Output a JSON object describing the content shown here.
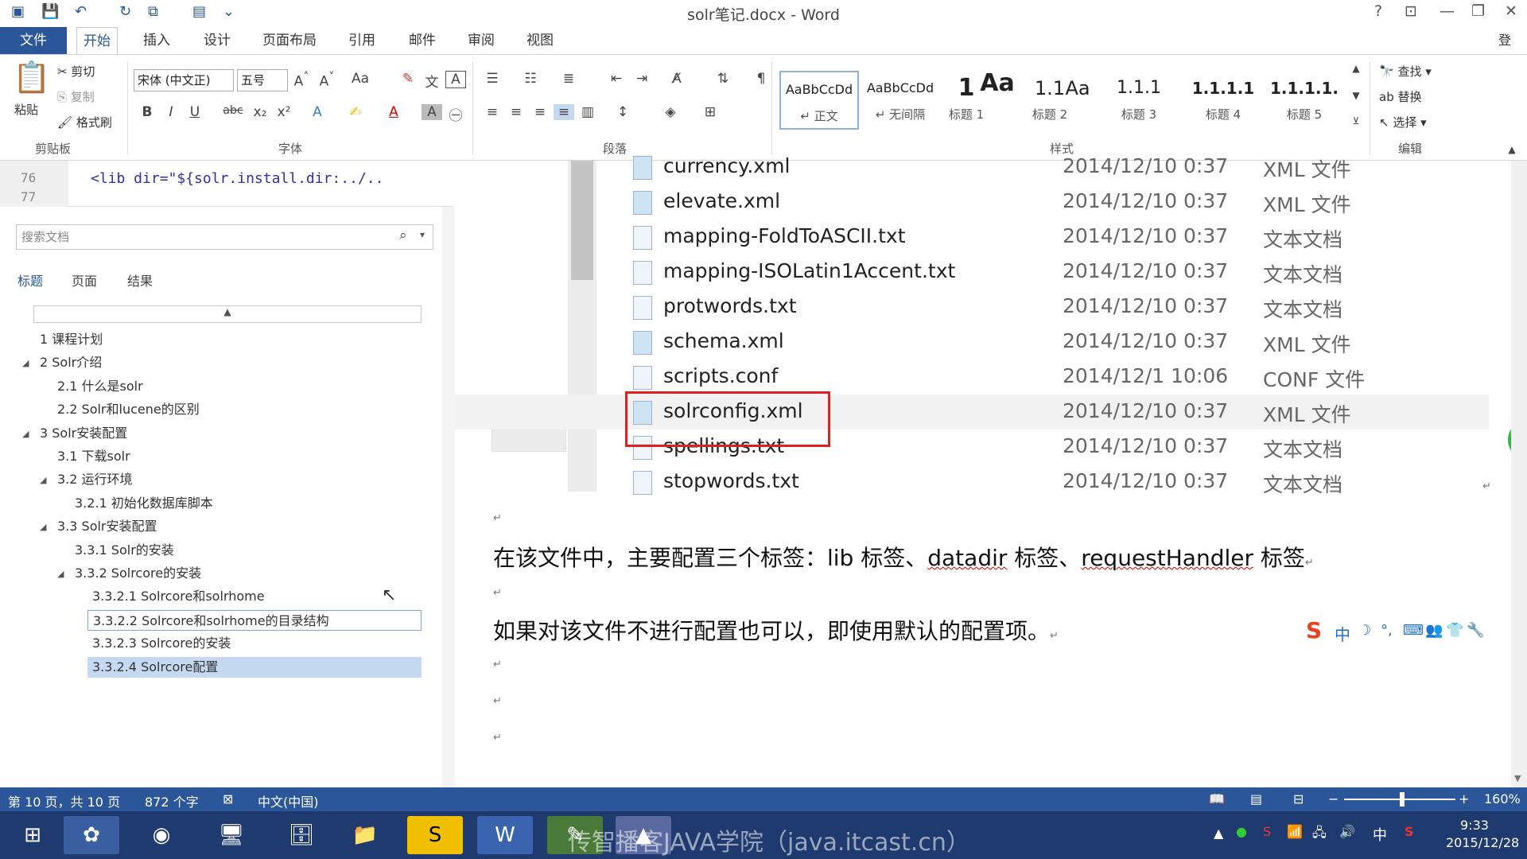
{
  "window": {
    "title": "solr笔记.docx - Word",
    "signin": "登录",
    "help": "?"
  },
  "tabs": [
    "文件",
    "开始",
    "插入",
    "设计",
    "页面布局",
    "引用",
    "邮件",
    "审阅",
    "视图"
  ],
  "ribbon": {
    "clipboard": {
      "paste": "粘贴",
      "cut": "剪切",
      "copy": "复制",
      "format_painter": "格式刷",
      "label": "剪贴板"
    },
    "font": {
      "name": "宋体 (中文正)",
      "size": "五号",
      "label": "字体"
    },
    "paragraph": {
      "label": "段落"
    },
    "styles": {
      "label": "样式",
      "items": [
        {
          "preview": "AaBbCcDd",
          "name": "↵ 正文"
        },
        {
          "preview": "AaBbCcDd",
          "name": "↵ 无间隔"
        },
        {
          "preview": "1",
          "name": "标题 1"
        },
        {
          "preview": "Aa",
          "name": ""
        },
        {
          "preview": "1.1",
          "name": "标题 2"
        },
        {
          "preview": "Aa",
          "name": ""
        },
        {
          "preview": "1.1.1",
          "name": "标题 3"
        },
        {
          "preview": "1.1.1.1",
          "name": "标题 4"
        },
        {
          "preview": "1.1.1.1.",
          "name": "标题 5"
        }
      ]
    },
    "editing": {
      "find": "查找",
      "replace": "替换",
      "select": "选择",
      "label": "编辑"
    }
  },
  "code": {
    "lines": [
      {
        "num": "76",
        "text": "<lib dir=\"${solr.install.dir:../.."
      },
      {
        "num": "77",
        "text": ""
      }
    ]
  },
  "nav": {
    "search_placeholder": "搜索文档",
    "tabs": [
      "标题",
      "页面",
      "结果"
    ],
    "items": [
      {
        "text": "1 课程计划",
        "level": 0,
        "arrow": ""
      },
      {
        "text": "2 Solr介绍",
        "level": 0,
        "arrow": "◢"
      },
      {
        "text": "2.1 什么是solr",
        "level": 1,
        "arrow": ""
      },
      {
        "text": "2.2 Solr和lucene的区别",
        "level": 1,
        "arrow": ""
      },
      {
        "text": "3 Solr安装配置",
        "level": 0,
        "arrow": "◢"
      },
      {
        "text": "3.1 下载solr",
        "level": 1,
        "arrow": ""
      },
      {
        "text": "3.2 运行环境",
        "level": 1,
        "arrow": "◢"
      },
      {
        "text": "3.2.1 初始化数据库脚本",
        "level": 2,
        "arrow": ""
      },
      {
        "text": "3.3 Solr安装配置",
        "level": 1,
        "arrow": "◢"
      },
      {
        "text": "3.3.1 Solr的安装",
        "level": 2,
        "arrow": ""
      },
      {
        "text": "3.3.2 Solrcore的安装",
        "level": 2,
        "arrow": "◢"
      },
      {
        "text": "3.3.2.1 Solrcore和solrhome",
        "level": 3,
        "arrow": ""
      },
      {
        "text": "3.3.2.2 Solrcore和solrhome的目录结构",
        "level": 3,
        "arrow": ""
      },
      {
        "text": "3.3.2.3 Solrcore的安装",
        "level": 3,
        "arrow": ""
      },
      {
        "text": "3.3.2.4 Solrcore配置",
        "level": 3,
        "arrow": ""
      }
    ]
  },
  "files": [
    {
      "name": "currency.xml",
      "date": "2014/12/10 0:37",
      "type": "XML 文件",
      "icon": "xml"
    },
    {
      "name": "elevate.xml",
      "date": "2014/12/10 0:37",
      "type": "XML 文件",
      "icon": "xml"
    },
    {
      "name": "mapping-FoldToASCII.txt",
      "date": "2014/12/10 0:37",
      "type": "文本文档",
      "icon": "txt"
    },
    {
      "name": "mapping-ISOLatin1Accent.txt",
      "date": "2014/12/10 0:37",
      "type": "文本文档",
      "icon": "txt"
    },
    {
      "name": "protwords.txt",
      "date": "2014/12/10 0:37",
      "type": "文本文档",
      "icon": "txt"
    },
    {
      "name": "schema.xml",
      "date": "2014/12/10 0:37",
      "type": "XML 文件",
      "icon": "xml"
    },
    {
      "name": "scripts.conf",
      "date": "2014/12/1 10:06",
      "type": "CONF 文件",
      "icon": "txt"
    },
    {
      "name": "solrconfig.xml",
      "date": "2014/12/10 0:37",
      "type": "XML 文件",
      "icon": "xml"
    },
    {
      "name": "spellings.txt",
      "date": "2014/12/10 0:37",
      "type": "文本文档",
      "icon": "txt"
    },
    {
      "name": "stopwords.txt",
      "date": "2014/12/10 0:37",
      "type": "文本文档",
      "icon": "txt"
    }
  ],
  "doc": {
    "para1": {
      "a": "在该文件中，主要配置三个标签：lib 标签、",
      "b": "datadir",
      "c": " 标签、",
      "d": "requestHandler",
      "e": " 标签"
    },
    "para2": "如果对该文件不进行配置也可以，即使用默认的配置项。",
    "pilcrow": "↵"
  },
  "ime": {
    "mode": "中"
  },
  "status": {
    "page": "第 10 页，共 10 页",
    "words": "872 个字",
    "language": "中文(中国)",
    "zoom": "160%"
  },
  "taskbar": {
    "watermark": "传智播客JAVA学院（java.itcast.cn）",
    "time": "9:33",
    "date": "2015/12/28",
    "ime": "中"
  },
  "colors": {
    "accent": "#2b579a",
    "selection_border": "#e02020"
  }
}
